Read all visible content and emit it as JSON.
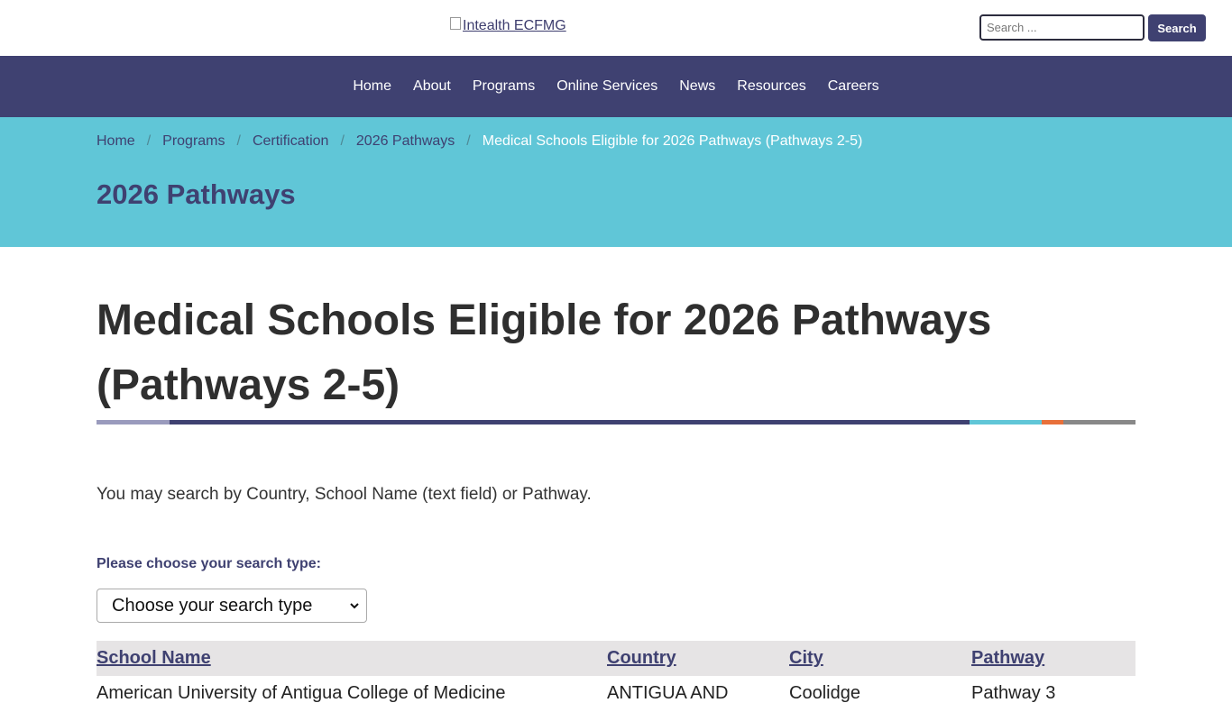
{
  "header": {
    "logo_alt": "Intealth ECFMG",
    "search_placeholder": "Search ...",
    "search_button": "Search"
  },
  "nav": {
    "items": [
      "Home",
      "About",
      "Programs",
      "Online Services",
      "News",
      "Resources",
      "Careers"
    ]
  },
  "breadcrumb": {
    "items": [
      "Home",
      "Programs",
      "Certification",
      "2026 Pathways"
    ],
    "current": "Medical Schools Eligible for 2026 Pathways (Pathways 2-5)",
    "separator": "/"
  },
  "hero": {
    "title": "2026 Pathways"
  },
  "main": {
    "title": "Medical Schools Eligible for 2026 Pathways (Pathways 2-5)",
    "intro": "You may search by Country, School Name (text field) or Pathway.",
    "search_label": "Please choose your search type:",
    "search_select_value": "Choose your search type"
  },
  "table": {
    "columns": [
      "School Name",
      "Country",
      "City",
      "Pathway"
    ],
    "rows": [
      [
        "American University of Antigua College of Medicine",
        "ANTIGUA AND",
        "Coolidge",
        "Pathway 3"
      ]
    ]
  },
  "colors": {
    "nav_bg": "#3f4171",
    "hero_bg": "#60c6d7",
    "rule_segments": [
      "#9a9bbd",
      "#3f4171",
      "#60c6d7",
      "#e8703a",
      "#888888"
    ]
  }
}
